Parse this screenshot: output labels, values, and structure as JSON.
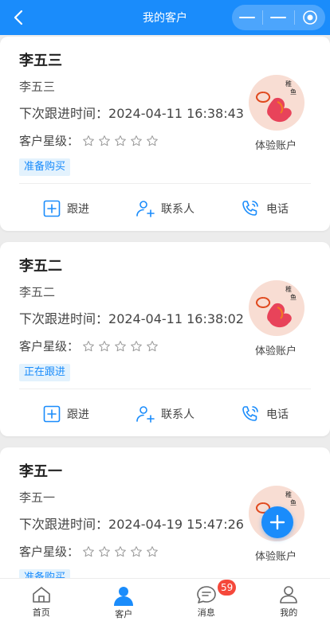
{
  "header": {
    "title": "我的客户",
    "back_icon": "chevron-left-icon",
    "capsule_icons": [
      "minus-icon",
      "minus-icon",
      "target-icon"
    ]
  },
  "theme": {
    "primary": "#1a8cfb",
    "badge": "#f5483b"
  },
  "customers": [
    {
      "name": "李五三",
      "sub": "李五三",
      "next_label": "下次跟进时间：",
      "next_time": "2024-04-11 16:38:43",
      "stars_label": "客户星级：",
      "stars": 0,
      "tag": "准备购买",
      "account": "体验账户"
    },
    {
      "name": "李五二",
      "sub": "李五二",
      "next_label": "下次跟进时间：",
      "next_time": "2024-04-11 16:38:02",
      "stars_label": "客户星级：",
      "stars": 0,
      "tag": "正在跟进",
      "account": "体验账户"
    },
    {
      "name": "李五一",
      "sub": "李五一",
      "next_label": "下次跟进时间：",
      "next_time": "2024-04-19 15:47:26",
      "stars_label": "客户星级：",
      "stars": 0,
      "tag": "准备购买",
      "account": "体验账户"
    }
  ],
  "actions": {
    "follow": "跟进",
    "contact": "联系人",
    "phone": "电话"
  },
  "fab_icon": "plus-icon",
  "tabbar": {
    "items": [
      {
        "label": "首页",
        "icon": "home-icon"
      },
      {
        "label": "客户",
        "icon": "user-icon"
      },
      {
        "label": "消息",
        "icon": "message-icon"
      },
      {
        "label": "我的",
        "icon": "profile-icon"
      }
    ],
    "active": 1,
    "badge": "59"
  }
}
